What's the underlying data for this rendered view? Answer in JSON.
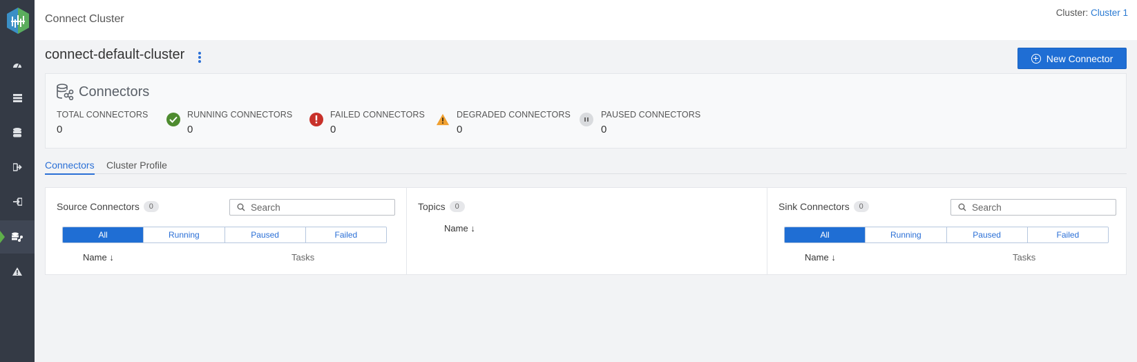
{
  "topbar": {
    "title": "Connect Cluster",
    "cluster_label": "Cluster:",
    "cluster_value": "Cluster 1"
  },
  "page": {
    "title": "connect-default-cluster",
    "new_button": "New Connector"
  },
  "summary": {
    "title": "Connectors",
    "stats": [
      {
        "label": "TOTAL CONNECTORS",
        "value": "0"
      },
      {
        "label": "RUNNING CONNECTORS",
        "value": "0",
        "icon": "check-circle-icon",
        "color": "#4e8b2f"
      },
      {
        "label": "FAILED CONNECTORS",
        "value": "0",
        "icon": "error-icon",
        "color": "#c8312a"
      },
      {
        "label": "DEGRADED CONNECTORS",
        "value": "0",
        "icon": "warning-icon",
        "color": "#f0a030"
      },
      {
        "label": "PAUSED CONNECTORS",
        "value": "0",
        "icon": "pause-icon",
        "color": "#d9dbde"
      }
    ]
  },
  "tabs": [
    "Connectors",
    "Cluster Profile"
  ],
  "source": {
    "title": "Source Connectors",
    "count": "0",
    "search_placeholder": "Search",
    "filters": [
      "All",
      "Running",
      "Paused",
      "Failed"
    ],
    "col_name": "Name",
    "col_tasks": "Tasks"
  },
  "topics": {
    "title": "Topics",
    "count": "0",
    "col_name": "Name"
  },
  "sink": {
    "title": "Sink Connectors",
    "count": "0",
    "search_placeholder": "Search",
    "filters": [
      "All",
      "Running",
      "Paused",
      "Failed"
    ],
    "col_name": "Name",
    "col_tasks": "Tasks"
  },
  "colors": {
    "accent": "#1f6ed4",
    "sidebar": "#343a45",
    "active_marker": "#5fb04a"
  },
  "sidebar_icons": [
    "dashboard-icon",
    "brokers-icon",
    "database-icon",
    "producers-icon",
    "consumers-icon",
    "connect-icon",
    "alerts-icon"
  ]
}
